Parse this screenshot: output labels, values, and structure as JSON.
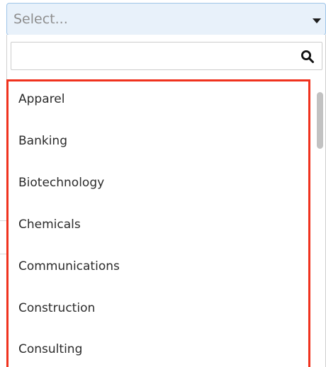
{
  "select": {
    "placeholder": "Select..."
  },
  "search": {
    "value": "",
    "placeholder": ""
  },
  "options": [
    {
      "label": "Apparel"
    },
    {
      "label": "Banking"
    },
    {
      "label": "Biotechnology"
    },
    {
      "label": "Chemicals"
    },
    {
      "label": "Communications"
    },
    {
      "label": "Construction"
    },
    {
      "label": "Consulting"
    }
  ],
  "icons": {
    "search": "search-icon",
    "caret": "caret-down-icon"
  },
  "colors": {
    "highlight_border": "#f0321e",
    "select_background": "#e8f1fa",
    "select_border": "#9fc5e8"
  }
}
